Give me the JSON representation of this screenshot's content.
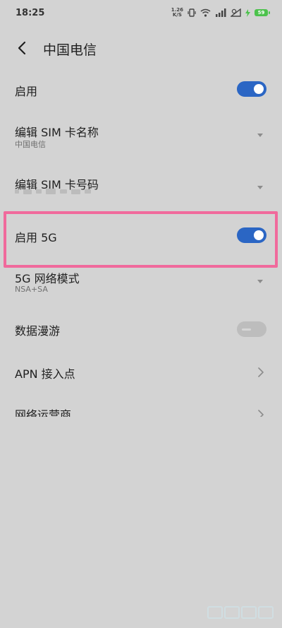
{
  "status_bar": {
    "time": "18:25",
    "net_rate_top": "1.26",
    "net_rate_bottom": "K/S",
    "battery_level": "59",
    "battery_color": "#4cc24c"
  },
  "header": {
    "back_icon": "chevron-left-icon",
    "title": "中国电信"
  },
  "settings": {
    "enable": {
      "label": "启用",
      "on": true
    },
    "sim_name": {
      "label": "编辑 SIM 卡名称",
      "value": "中国电信"
    },
    "sim_number": {
      "label": "编辑 SIM 卡号码"
    },
    "enable_5g": {
      "label": "启用 5G",
      "on": true
    },
    "network_mode": {
      "label": "5G 网络模式",
      "value": "NSA+SA"
    },
    "data_roaming": {
      "label": "数据漫游",
      "on": false
    },
    "apn": {
      "label": "APN 接入点"
    },
    "carrier": {
      "label": "网络运营商"
    }
  },
  "colors": {
    "accent": "#2b66c4",
    "background": "#d3d3d3",
    "highlight": "#f06a9c"
  }
}
